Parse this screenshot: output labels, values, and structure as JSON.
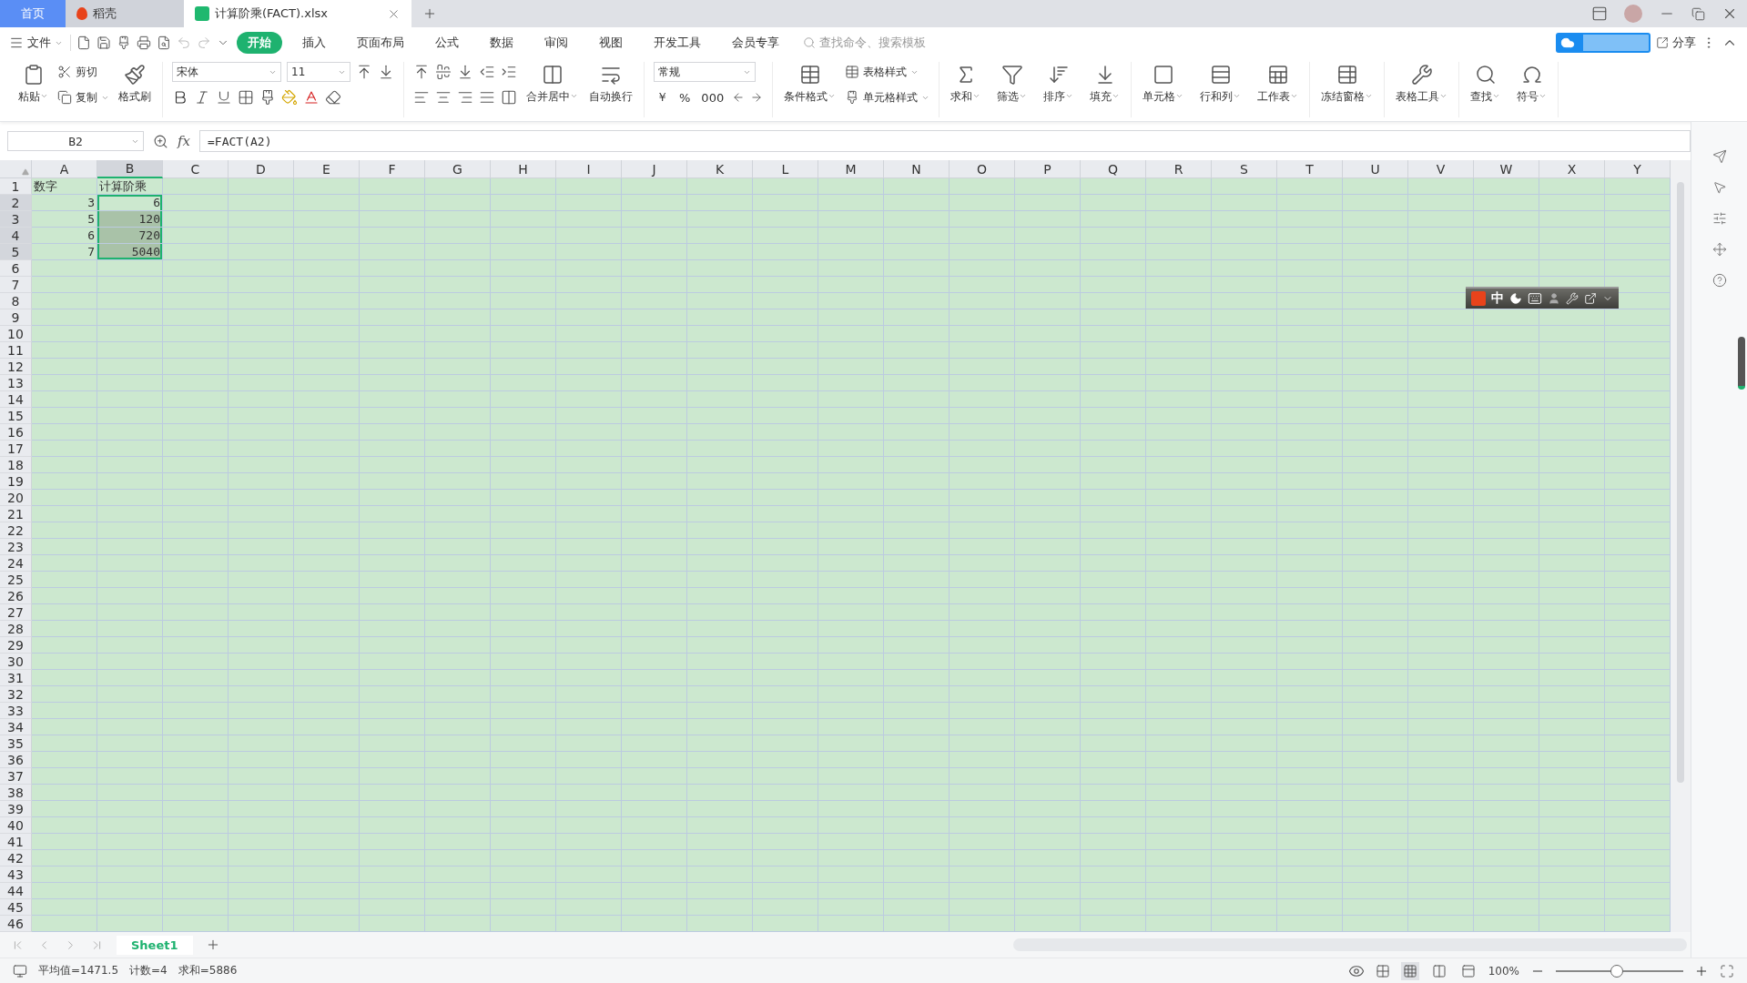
{
  "tabs": [
    {
      "label": "首页",
      "kind": "home",
      "selected": false
    },
    {
      "label": "稻壳",
      "kind": "docer",
      "selected": false
    },
    {
      "label": "计算阶乘(FACT).xlsx",
      "kind": "document",
      "selected": true
    }
  ],
  "menu": {
    "file": "文件",
    "items": [
      {
        "label": "开始",
        "selected": true
      },
      {
        "label": "插入",
        "selected": false
      },
      {
        "label": "页面布局",
        "selected": false
      },
      {
        "label": "公式",
        "selected": false
      },
      {
        "label": "数据",
        "selected": false
      },
      {
        "label": "审阅",
        "selected": false
      },
      {
        "label": "视图",
        "selected": false
      },
      {
        "label": "开发工具",
        "selected": false
      },
      {
        "label": "会员专享",
        "selected": false
      }
    ],
    "search": {
      "placeholder": "查找命令、搜索模板"
    },
    "share": "分享"
  },
  "ribbon": {
    "clipboard": {
      "paste": "粘贴",
      "cut": "剪切",
      "copy": "复制",
      "format_painter": "格式刷"
    },
    "font": {
      "name": "宋体",
      "size": "11"
    },
    "alignment": {
      "merge": "合并居中",
      "wrap": "自动换行"
    },
    "number": {
      "format": "常规",
      "symbols": [
        "￥",
        "%",
        "000"
      ]
    },
    "styles": {
      "table_style": "表格样式",
      "cell_style": "单元格样式",
      "conditional": "条件格式"
    },
    "tools": [
      {
        "label": "求和"
      },
      {
        "label": "筛选"
      },
      {
        "label": "排序"
      },
      {
        "label": "填充"
      },
      {
        "label": "单元格"
      },
      {
        "label": "行和列"
      },
      {
        "label": "工作表"
      },
      {
        "label": "冻结窗格"
      },
      {
        "label": "表格工具"
      },
      {
        "label": "查找"
      },
      {
        "label": "符号"
      }
    ]
  },
  "formula_bar": {
    "name_box": "B2",
    "fx": "fx",
    "formula": "=FACT(A2)"
  },
  "columns": [
    {
      "label": "A",
      "selected": false
    },
    {
      "label": "B",
      "selected": true
    },
    {
      "label": "C",
      "selected": false
    },
    {
      "label": "D",
      "selected": false
    },
    {
      "label": "E",
      "selected": false
    },
    {
      "label": "F",
      "selected": false
    },
    {
      "label": "G",
      "selected": false
    },
    {
      "label": "H",
      "selected": false
    },
    {
      "label": "I",
      "selected": false
    },
    {
      "label": "J",
      "selected": false
    },
    {
      "label": "K",
      "selected": false
    },
    {
      "label": "L",
      "selected": false
    },
    {
      "label": "M",
      "selected": false
    },
    {
      "label": "N",
      "selected": false
    },
    {
      "label": "O",
      "selected": false
    },
    {
      "label": "P",
      "selected": false
    },
    {
      "label": "Q",
      "selected": false
    },
    {
      "label": "R",
      "selected": false
    },
    {
      "label": "S",
      "selected": false
    },
    {
      "label": "T",
      "selected": false
    },
    {
      "label": "U",
      "selected": false
    },
    {
      "label": "V",
      "selected": false
    },
    {
      "label": "W",
      "selected": false
    },
    {
      "label": "X",
      "selected": false
    },
    {
      "label": "Y",
      "selected": false
    }
  ],
  "rows": [
    {
      "header": "1",
      "selected": false,
      "cells": [
        {
          "text": "数字",
          "kind": "text",
          "selected": false,
          "active": false
        },
        {
          "text": "计算阶乘",
          "kind": "text",
          "selected": false,
          "active": false
        }
      ]
    },
    {
      "header": "2",
      "selected": true,
      "cells": [
        {
          "text": "3",
          "kind": "number",
          "selected": false,
          "active": false
        },
        {
          "text": "6",
          "kind": "number",
          "selected": true,
          "active": true
        }
      ]
    },
    {
      "header": "3",
      "selected": true,
      "cells": [
        {
          "text": "5",
          "kind": "number",
          "selected": false,
          "active": false
        },
        {
          "text": "120",
          "kind": "number",
          "selected": true,
          "active": false
        }
      ]
    },
    {
      "header": "4",
      "selected": true,
      "cells": [
        {
          "text": "6",
          "kind": "number",
          "selected": false,
          "active": false
        },
        {
          "text": "720",
          "kind": "number",
          "selected": true,
          "active": false
        }
      ]
    },
    {
      "header": "5",
      "selected": true,
      "cells": [
        {
          "text": "7",
          "kind": "number",
          "selected": false,
          "active": false
        },
        {
          "text": "5040",
          "kind": "number",
          "selected": true,
          "active": false
        }
      ]
    },
    {
      "header": "6",
      "selected": false
    },
    {
      "header": "7",
      "selected": false
    },
    {
      "header": "8",
      "selected": false
    },
    {
      "header": "9",
      "selected": false
    },
    {
      "header": "10",
      "selected": false
    },
    {
      "header": "11",
      "selected": false
    },
    {
      "header": "12",
      "selected": false
    },
    {
      "header": "13",
      "selected": false
    },
    {
      "header": "14",
      "selected": false
    },
    {
      "header": "15",
      "selected": false
    },
    {
      "header": "16",
      "selected": false
    },
    {
      "header": "17",
      "selected": false
    },
    {
      "header": "18",
      "selected": false
    },
    {
      "header": "19",
      "selected": false
    },
    {
      "header": "20",
      "selected": false
    },
    {
      "header": "21",
      "selected": false
    },
    {
      "header": "22",
      "selected": false
    },
    {
      "header": "23",
      "selected": false
    },
    {
      "header": "24",
      "selected": false
    },
    {
      "header": "25",
      "selected": false
    },
    {
      "header": "26",
      "selected": false
    },
    {
      "header": "27",
      "selected": false
    },
    {
      "header": "28",
      "selected": false
    },
    {
      "header": "29",
      "selected": false
    },
    {
      "header": "30",
      "selected": false
    },
    {
      "header": "31",
      "selected": false
    },
    {
      "header": "32",
      "selected": false
    },
    {
      "header": "33",
      "selected": false
    },
    {
      "header": "34",
      "selected": false
    },
    {
      "header": "35",
      "selected": false
    },
    {
      "header": "36",
      "selected": false
    },
    {
      "header": "37",
      "selected": false
    },
    {
      "header": "38",
      "selected": false
    },
    {
      "header": "39",
      "selected": false
    },
    {
      "header": "40",
      "selected": false
    },
    {
      "header": "41",
      "selected": false
    },
    {
      "header": "42",
      "selected": false
    },
    {
      "header": "43",
      "selected": false
    },
    {
      "header": "44",
      "selected": false
    },
    {
      "header": "45",
      "selected": false
    },
    {
      "header": "46",
      "selected": false
    }
  ],
  "ime_toolbar": {
    "mode": "中"
  },
  "sheets": [
    {
      "label": "Sheet1",
      "selected": true
    }
  ],
  "status_bar": {
    "stats": [
      "平均值=1471.5",
      "计数=4",
      "求和=5886"
    ],
    "zoom": "100%",
    "zoom_slider": {
      "level": 0.48
    }
  }
}
